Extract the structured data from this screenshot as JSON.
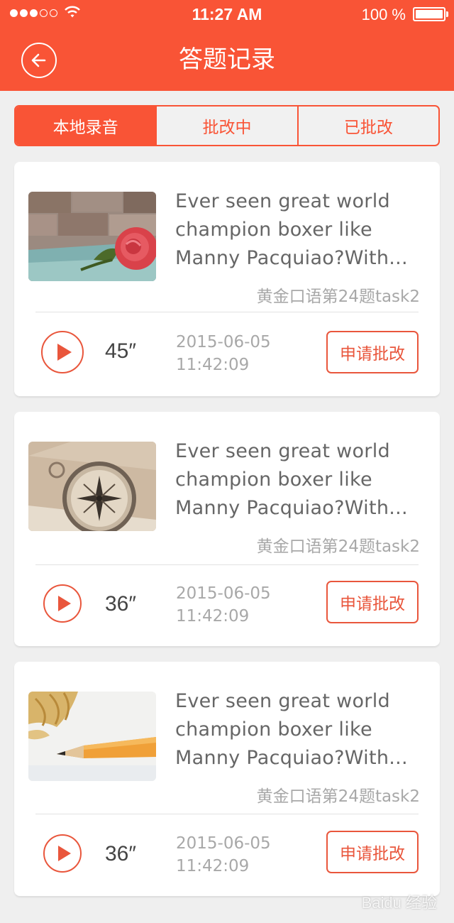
{
  "status_bar": {
    "time": "11:27 AM",
    "battery": "100 %",
    "signal_bars": 5,
    "signal_filled": 3
  },
  "header": {
    "title": "答题记录"
  },
  "tabs": [
    {
      "label": "本地录音",
      "active": true
    },
    {
      "label": "批改中",
      "active": false
    },
    {
      "label": "已批改",
      "active": false
    }
  ],
  "records": [
    {
      "title": "Ever seen great world champion boxer like Manny Pacquiao?With...",
      "subtitle": "黄金口语第24题task2",
      "duration": "45″",
      "date": "2015-06-05",
      "time": "11:42:09",
      "button": "申请批改",
      "thumbnail": "rose"
    },
    {
      "title": "Ever seen great world champion boxer like Manny Pacquiao?With...",
      "subtitle": "黄金口语第24题task2",
      "duration": "36″",
      "date": "2015-06-05",
      "time": "11:42:09",
      "button": "申请批改",
      "thumbnail": "compass"
    },
    {
      "title": "Ever seen great world champion boxer like Manny Pacquiao?With...",
      "subtitle": "黄金口语第24题task2",
      "duration": "36″",
      "date": "2015-06-05",
      "time": "11:42:09",
      "button": "申请批改",
      "thumbnail": "pencil"
    }
  ],
  "watermark": "Baidu 经验",
  "colors": {
    "accent": "#f95436",
    "background": "#efefef",
    "card": "#ffffff",
    "muted_text": "#a8a8a8"
  }
}
